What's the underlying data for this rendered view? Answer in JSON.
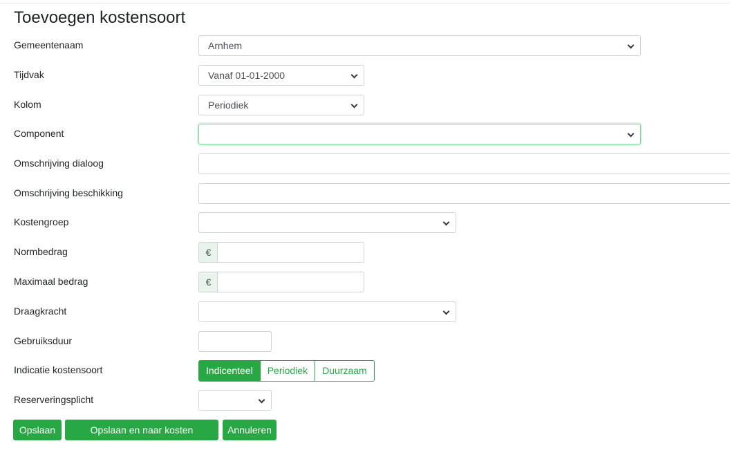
{
  "page": {
    "title": "Toevoegen kostensoort"
  },
  "form": {
    "gemeentenaam": {
      "label": "Gemeentenaam",
      "value": "Arnhem"
    },
    "tijdvak": {
      "label": "Tijdvak",
      "value": "Vanaf 01-01-2000"
    },
    "kolom": {
      "label": "Kolom",
      "value": "Periodiek"
    },
    "component": {
      "label": "Component",
      "value": ""
    },
    "omschrijving_dialoog": {
      "label": "Omschrijving dialoog",
      "value": ""
    },
    "omschrijving_beschikking": {
      "label": "Omschrijving beschikking",
      "value": ""
    },
    "kostengroep": {
      "label": "Kostengroep",
      "value": ""
    },
    "normbedrag": {
      "label": "Normbedrag",
      "currency": "€",
      "value": ""
    },
    "maximaal_bedrag": {
      "label": "Maximaal bedrag",
      "currency": "€",
      "value": ""
    },
    "draagkracht": {
      "label": "Draagkracht",
      "value": ""
    },
    "gebruiksduur": {
      "label": "Gebruiksduur",
      "value": ""
    },
    "indicatie": {
      "label": "Indicatie kostensoort",
      "options": [
        "Indicenteel",
        "Periodiek",
        "Duurzaam"
      ],
      "selected": "Indicenteel"
    },
    "reserveringsplicht": {
      "label": "Reserveringsplicht",
      "value": ""
    }
  },
  "actions": {
    "save": "Opslaan",
    "save_and_go": "Opslaan en naar kosten onderdelen",
    "cancel": "Annuleren"
  },
  "colors": {
    "accent": "#28a745",
    "focus_border": "#7fd39a",
    "addon_bg": "#e9f5ec"
  }
}
